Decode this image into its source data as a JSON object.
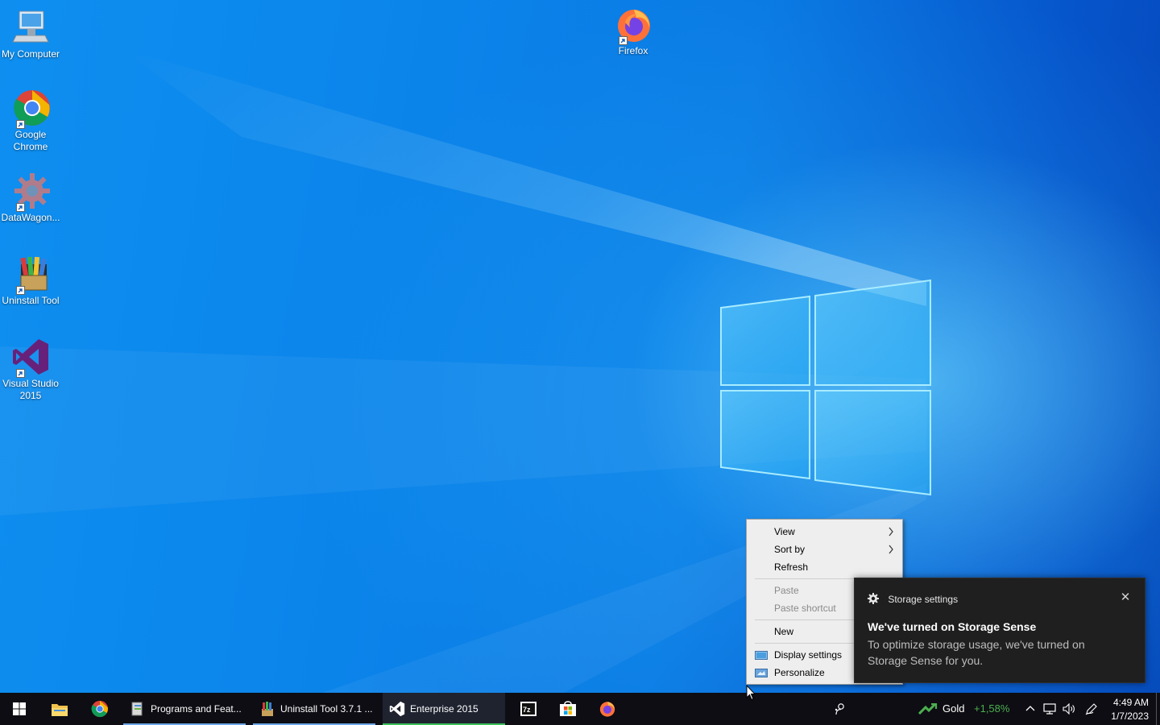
{
  "desktop": {
    "icons": [
      {
        "label": "My Computer"
      },
      {
        "label": "Google Chrome"
      },
      {
        "label": "DataWagon..."
      },
      {
        "label": "Uninstall Tool"
      },
      {
        "label": "Visual Studio 2015"
      },
      {
        "label": "Firefox"
      }
    ]
  },
  "context_menu": {
    "items": {
      "view": "View",
      "sort_by": "Sort by",
      "refresh": "Refresh",
      "paste": "Paste",
      "paste_shortcut": "Paste shortcut",
      "new": "New",
      "display_settings": "Display settings",
      "personalize": "Personalize"
    }
  },
  "toast": {
    "app_name": "Storage settings",
    "title": "We've turned on Storage Sense",
    "body": "To optimize storage usage, we've turned on Storage Sense for you.",
    "close_icon": "close-icon"
  },
  "taskbar": {
    "apps": [
      {
        "label": "Programs and Feat..."
      },
      {
        "label": "Uninstall Tool 3.7.1 ..."
      },
      {
        "label": "Enterprise 2015"
      }
    ],
    "pinned_icons": [
      "windows-start-icon",
      "file-explorer-icon",
      "chrome-icon",
      "7zip-icon",
      "store-icon",
      "firefox-icon"
    ],
    "stock": {
      "name": "Gold",
      "change": "+1,58%",
      "color": "#4caf50"
    },
    "clock": {
      "time": "4:49 AM",
      "date": "1/7/2023"
    }
  }
}
